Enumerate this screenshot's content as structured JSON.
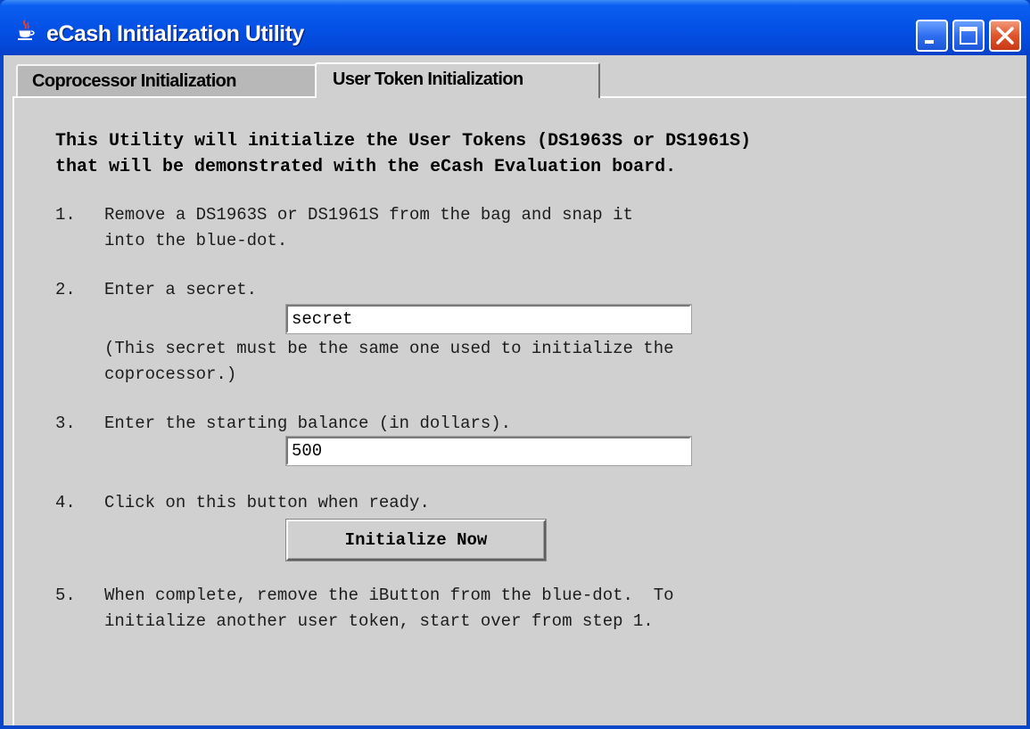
{
  "window": {
    "title": "eCash Initialization Utility"
  },
  "tabs": [
    {
      "label": "Coprocessor Initialization",
      "selected": false
    },
    {
      "label": "User Token Initialization",
      "selected": true
    }
  ],
  "content": {
    "heading_line1": "This Utility will initialize the User Tokens (DS1963S or DS1961S)",
    "heading_line2": "that will be demonstrated with the eCash Evaluation board.",
    "step1": {
      "number": "1.",
      "line1": "Remove a DS1963S or DS1961S from the bag and snap it",
      "line2": "into the blue-dot."
    },
    "step2": {
      "number": "2.",
      "line1": "Enter a secret.",
      "secret_value": "secret",
      "note_line1": "(This secret must be the same one used to initialize the",
      "note_line2": "coprocessor.)"
    },
    "step3": {
      "number": "3.",
      "line1": "Enter the starting balance (in dollars).",
      "balance_value": "500"
    },
    "step4": {
      "number": "4.",
      "line1": "Click on this button when ready.",
      "button_label": "Initialize Now"
    },
    "step5": {
      "number": "5.",
      "line1": "When complete, remove the iButton from the blue-dot.  To",
      "line2": "initialize another user token, start over from step 1."
    }
  },
  "colors": {
    "titlebar": "#0551e6",
    "panel": "#d0d0d0",
    "close_button": "#e0532c"
  }
}
